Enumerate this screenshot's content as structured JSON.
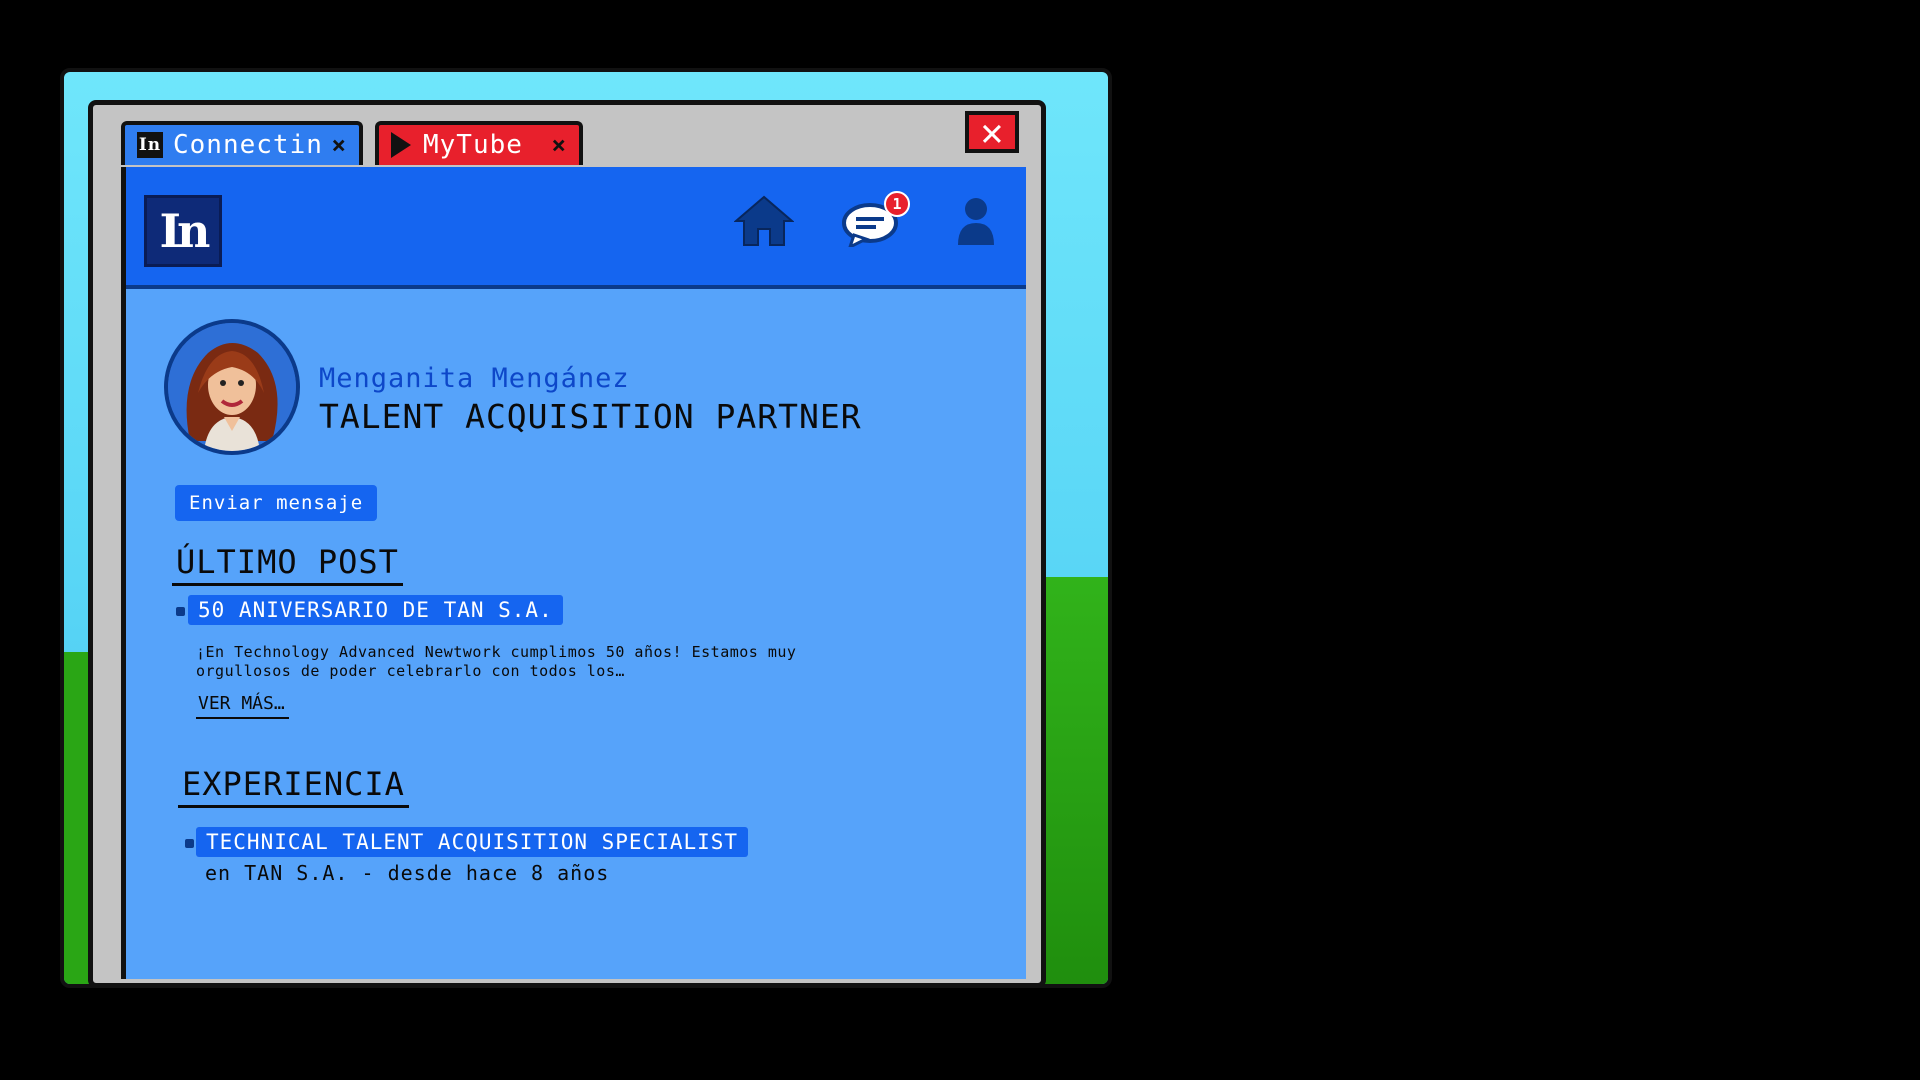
{
  "tabs": [
    {
      "label": "Connectin",
      "logo": "In",
      "close": "×",
      "color": "#2f7df0"
    },
    {
      "label": "MyTube",
      "close": "×",
      "color": "#e8202c"
    }
  ],
  "window": {
    "close_label": "✕"
  },
  "header": {
    "logo": "In",
    "icons": [
      "home-icon",
      "messages-icon",
      "profile-icon"
    ],
    "messages_badge": "1"
  },
  "profile": {
    "name": "Menganita Mengánez",
    "title": "TALENT ACQUISITION PARTNER",
    "send_message_label": "Enviar mensaje"
  },
  "latest_post": {
    "section_title": "ÚLTIMO POST",
    "title": "50 ANIVERSARIO DE TAN S.A.",
    "excerpt": "¡En Technology Advanced Newtwork cumplimos 50 años! Estamos muy orgullosos de poder celebrarlo con todos los…",
    "see_more_label": "VER MÁS…"
  },
  "experience": {
    "section_title": "EXPERIENCIA",
    "items": [
      {
        "title": "TECHNICAL TALENT ACQUISITION SPECIALIST",
        "detail": "en TAN S.A. - desde hace 8 años"
      }
    ]
  },
  "colors": {
    "brand_blue": "#1565f0",
    "page_blue": "#56a3fa",
    "alert_red": "#e8202c",
    "sky": "#59d6f6",
    "grass": "#2aa615"
  }
}
